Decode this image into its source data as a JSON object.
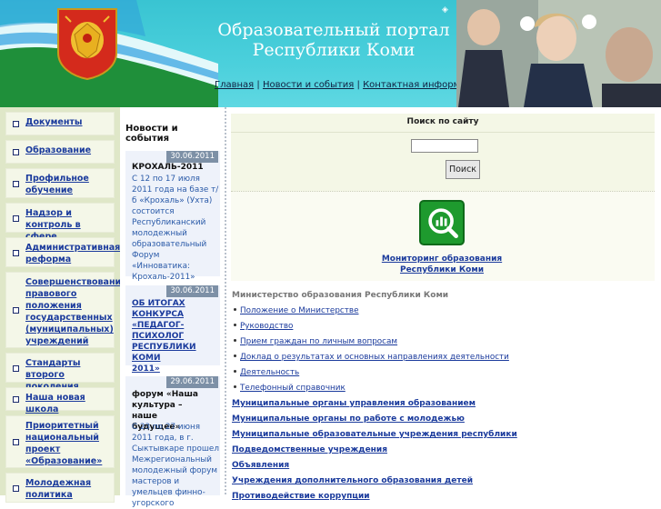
{
  "header": {
    "title_line1": "Образовательный портал",
    "title_line2": "Республики Коми",
    "nav": [
      {
        "label": "Главная"
      },
      {
        "label": "Новости и события"
      },
      {
        "label": "Контактная информация"
      }
    ],
    "nav_separator": "|"
  },
  "leftnav": {
    "items": [
      {
        "label": "Документы"
      },
      {
        "label": "Образование"
      },
      {
        "label": "Профильное обучение"
      },
      {
        "label": "Надзор и контроль в сфере образования"
      },
      {
        "label": "Административная реформа"
      },
      {
        "label": "Совершенствование правового положения государственных (муниципальных) учреждений"
      },
      {
        "label": "Стандарты второго поколения"
      },
      {
        "label": "Наша новая школа"
      },
      {
        "label": "Приоритетный национальный проект «Образование»"
      },
      {
        "label": "Молодежная политика"
      }
    ]
  },
  "news": {
    "heading": "Новости и события",
    "items": [
      {
        "date": "30.06.2011",
        "title": "КРОХАЛЬ-2011",
        "text": "С 12 по 17 июля 2011 года на базе т/б «Крохаль» (Ухта) состоится Республиканский молодежный образовательный Форум «Инноватика: Крохаль-2011»"
      },
      {
        "date": "30.06.2011",
        "title": "ОБ ИТОГАХ КОНКУРСА «ПЕДАГОГ-ПСИХОЛОГ РЕСПУБЛИКИ КОМИ 2011»",
        "text": ""
      },
      {
        "date": "29.06.2011",
        "title": "форум «Наша культура – наше будущее»",
        "text": "С 23 по 27 июня 2011 года, в г. Сыктывкаре прошел Межрегиональный молодежный форум мастеров и умельцев финно-угорского"
      }
    ]
  },
  "search": {
    "title": "Поиск по сайту",
    "input_value": "",
    "button_label": "Поиск"
  },
  "monitoring": {
    "link_text": "Мониторинг образования Республики Коми"
  },
  "ministry": {
    "heading": "Министерство образования Республики Коми",
    "links": [
      {
        "label": "Положение о Министерстве"
      },
      {
        "label": "Руководство"
      },
      {
        "label": "Прием граждан по личным вопросам"
      },
      {
        "label": "Доклад о результатах и основных направлениях деятельности"
      },
      {
        "label": "Деятельность"
      },
      {
        "label": "Телефонный справочник"
      }
    ]
  },
  "sections": [
    {
      "label": "Муниципальные органы управления образованием"
    },
    {
      "label": "Муниципальные органы по работе с молодежью"
    },
    {
      "label": "Муниципальные образовательные учреждения республики"
    },
    {
      "label": "Подведомственные учреждения"
    },
    {
      "label": "Объявления"
    },
    {
      "label": "Учреждения дополнительного образования детей"
    },
    {
      "label": "Противодействие коррупции"
    }
  ],
  "colors": {
    "header_bg": "#43c8d6",
    "leftnav_bg": "#dfe7c8",
    "link": "#1a3a9c",
    "news_date_bg": "#7d90a6",
    "monitor_icon": "#1e9a2e"
  }
}
